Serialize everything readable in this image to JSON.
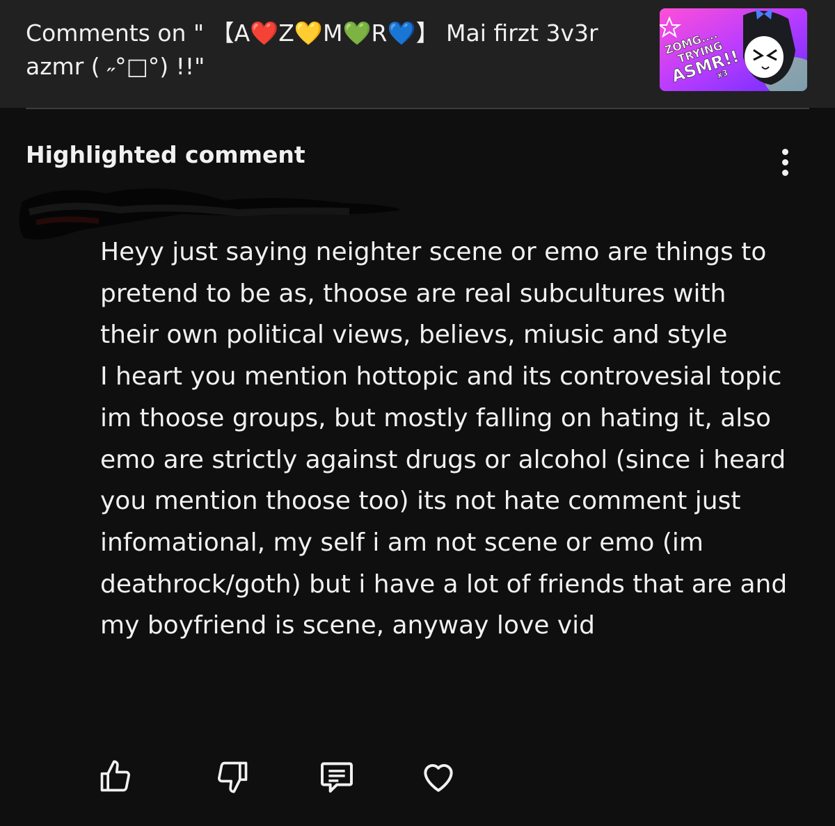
{
  "header": {
    "title": "Comments on \" 【A❤️Z💛M💚R💙】 Mai firzt 3v3r azmr ( ˶°□°) !!\"",
    "thumbnail": {
      "text": "ZOMG.... TRYING ASMR!! x3",
      "icon": "video-thumbnail"
    }
  },
  "comment": {
    "section_label": "Highlighted comment",
    "author_redacted": true,
    "body": "Heyy just saying neighter scene or emo are things to pretend to be as, thoose are real subcultures with their own political views, believs, miusic and style\nI heart you mention hottopic and its controvesial topic im thoose groups, but mostly falling on hating it, also emo are strictly against drugs or alcohol (since i heard you mention thoose too) its not hate comment just infomational, my self i am not scene or emo (im deathrock/goth) but i have a lot of friends that are and my boyfriend is scene, anyway love vid"
  },
  "actions": [
    {
      "name": "like",
      "icon": "thumbs-up-icon"
    },
    {
      "name": "dislike",
      "icon": "thumbs-down-icon"
    },
    {
      "name": "reply",
      "icon": "comment-icon"
    },
    {
      "name": "heart",
      "icon": "heart-icon"
    }
  ],
  "colors": {
    "background": "#0f0f0f",
    "header_background": "#212121",
    "text": "#f1f1f1",
    "divider": "#3d3d3d"
  }
}
